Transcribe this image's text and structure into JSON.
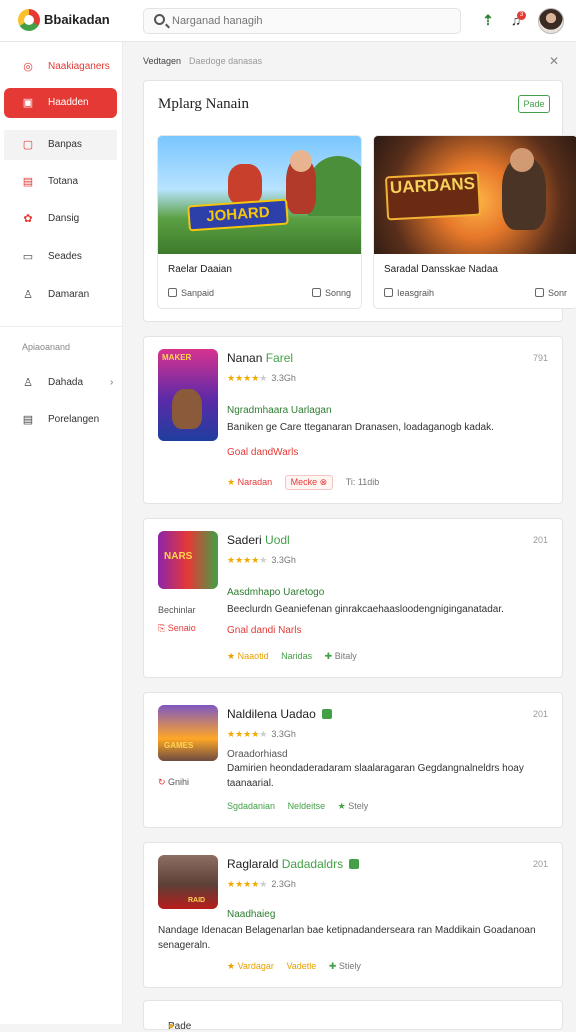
{
  "app": {
    "title": "Bbaikadan"
  },
  "search": {
    "placeholder": "Narganad hanagih"
  },
  "topbar": {
    "notification_count": "3"
  },
  "sidebar": {
    "items": [
      {
        "label": "Naakiaganers",
        "icon": "target-icon"
      },
      {
        "label": "Haadden",
        "icon": "home-icon"
      },
      {
        "label": "Banpas",
        "icon": "grid-icon"
      },
      {
        "label": "Totana",
        "icon": "list-icon"
      },
      {
        "label": "Dansig",
        "icon": "flower-icon"
      },
      {
        "label": "Seades",
        "icon": "square-icon"
      },
      {
        "label": "Damaran",
        "icon": "user-icon"
      }
    ],
    "section_label": "Apiaoanand",
    "section_items": [
      {
        "label": "Dahada",
        "icon": "person-icon"
      },
      {
        "label": "Porelangen",
        "icon": "document-icon"
      }
    ]
  },
  "breadcrumb": {
    "current": "Vedtagen",
    "sub": "Daedoge danasas"
  },
  "featured": {
    "title": "Mplarg Nanain",
    "action": "Pade",
    "items": [
      {
        "art_text": "JOHARD",
        "title": "Raelar Daaian",
        "meta": "Sanpaid",
        "action": "Sonng"
      },
      {
        "art_text": "UARDANS",
        "title": "Saradal Dansskae Nadaa",
        "meta": "Ieasgraih",
        "action": "Sonr"
      }
    ]
  },
  "games": [
    {
      "name": "Nanan",
      "tag": "Farel",
      "number": "791",
      "rating": "3.3Gh",
      "category": "Ngradmhaara Uarlagan",
      "description": "Baniken ge Care tteganaran Dranasen, loadaganogb kadak.",
      "highlight": "Goal dandWarls",
      "chips": [
        "Naradan",
        "Mecke",
        "Ti: 11dib"
      ],
      "thumb_text": "MAKER"
    },
    {
      "name": "Saderi",
      "tag": "Uodl",
      "number": "201",
      "rating": "3.3Gh",
      "category": "Aasdmhapo Uaretogo",
      "description": "Beeclurdn Geaniefenan ginrakcaehaasloodengniginganatadar.",
      "highlight": "Gnal dandi Narls",
      "chips": [
        "Naaotid",
        "Naridas",
        "Bitaly"
      ],
      "side_label": "Bechinlar",
      "side_action": "Senaio",
      "thumb_text": "NARS"
    },
    {
      "name": "Naldilena",
      "tag": "Uadao",
      "number": "201",
      "rating": "3.3Gh",
      "category": "Oraadorhiasd",
      "description": "Damirien heondaderadaram slaalaragaran Gegdangnalneldrs hoay taanaarial.",
      "chips": [
        "Sgdadanian",
        "Neldeitse",
        "Stely"
      ],
      "side_action": "Gnihi",
      "thumb_text": "GAMES"
    },
    {
      "name": "Raglarald",
      "tag": "Dadadaldrs",
      "number": "201",
      "rating": "2.3Gh",
      "category": "Naadhaieg",
      "description": "Nandage Idenacan Belagenarlan bae ketipnadanderseara ran Maddikain Goadanoan senageraln.",
      "chips": [
        "Vardagar",
        "Vadetle",
        "Stiely"
      ],
      "thumb_text": "RAID"
    }
  ],
  "footer": {
    "label": "Pade"
  },
  "colors": {
    "accent": "#e53935",
    "green": "#43a047",
    "star": "#f2a900"
  }
}
